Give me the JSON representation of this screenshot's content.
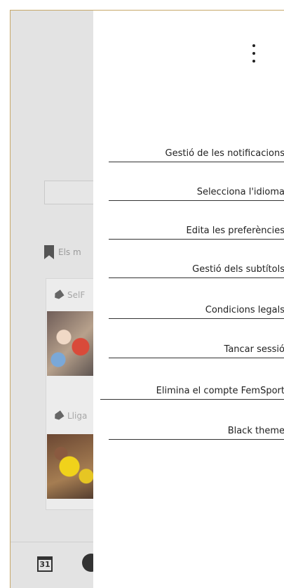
{
  "background": {
    "section_label": "Els m",
    "card_tags": [
      "SelF",
      "Lliga"
    ],
    "calendar_day": "31"
  },
  "menu": {
    "items": [
      "Gestió de les notificacions",
      "Selecciona l'idioma",
      "Edita les preferències",
      "Gestió dels subtítols",
      "Condicions legals",
      "Tancar sessió",
      "Elimina el compte FemSport",
      "Black theme"
    ]
  }
}
